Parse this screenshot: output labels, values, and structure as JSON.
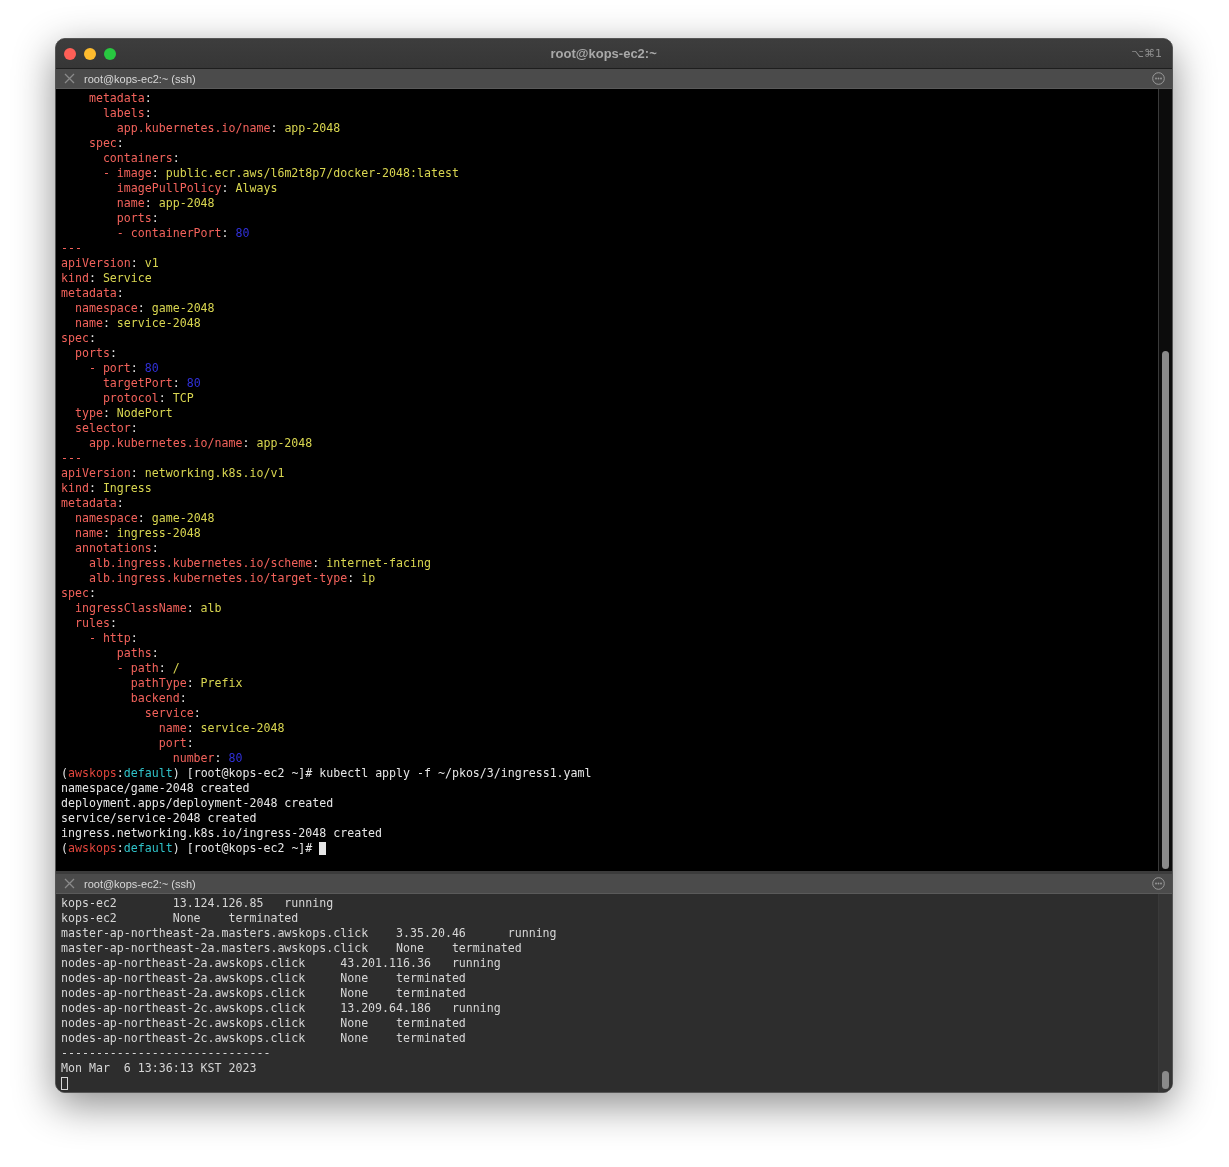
{
  "window": {
    "title": "root@kops-ec2:~",
    "shortcut": "⌥⌘1"
  },
  "panes": [
    {
      "title": "root@kops-ec2:~ (ssh)",
      "active": true,
      "lines": [
        [
          {
            "kind": "key",
            "text": "    metadata"
          },
          {
            "kind": "punct",
            "text": ":"
          }
        ],
        [
          {
            "kind": "key",
            "text": "      labels"
          },
          {
            "kind": "punct",
            "text": ":"
          }
        ],
        [
          {
            "kind": "key",
            "text": "        app.kubernetes.io/name"
          },
          {
            "kind": "punct",
            "text": ": "
          },
          {
            "kind": "value",
            "text": "app-2048"
          }
        ],
        [
          {
            "kind": "key",
            "text": "    spec"
          },
          {
            "kind": "punct",
            "text": ":"
          }
        ],
        [
          {
            "kind": "key",
            "text": "      containers"
          },
          {
            "kind": "punct",
            "text": ":"
          }
        ],
        [
          {
            "kind": "key",
            "text": "      - image"
          },
          {
            "kind": "punct",
            "text": ": "
          },
          {
            "kind": "value",
            "text": "public.ecr.aws/l6m2t8p7/docker-2048:latest"
          }
        ],
        [
          {
            "kind": "key",
            "text": "        imagePullPolicy"
          },
          {
            "kind": "punct",
            "text": ": "
          },
          {
            "kind": "value",
            "text": "Always"
          }
        ],
        [
          {
            "kind": "key",
            "text": "        name"
          },
          {
            "kind": "punct",
            "text": ": "
          },
          {
            "kind": "value",
            "text": "app-2048"
          }
        ],
        [
          {
            "kind": "key",
            "text": "        ports"
          },
          {
            "kind": "punct",
            "text": ":"
          }
        ],
        [
          {
            "kind": "key",
            "text": "        - containerPort"
          },
          {
            "kind": "punct",
            "text": ": "
          },
          {
            "kind": "number",
            "text": "80"
          }
        ],
        [
          {
            "kind": "key",
            "text": "---"
          }
        ],
        [
          {
            "kind": "key",
            "text": "apiVersion"
          },
          {
            "kind": "punct",
            "text": ": "
          },
          {
            "kind": "value",
            "text": "v1"
          }
        ],
        [
          {
            "kind": "key",
            "text": "kind"
          },
          {
            "kind": "punct",
            "text": ": "
          },
          {
            "kind": "value",
            "text": "Service"
          }
        ],
        [
          {
            "kind": "key",
            "text": "metadata"
          },
          {
            "kind": "punct",
            "text": ":"
          }
        ],
        [
          {
            "kind": "key",
            "text": "  namespace"
          },
          {
            "kind": "punct",
            "text": ": "
          },
          {
            "kind": "value",
            "text": "game-2048"
          }
        ],
        [
          {
            "kind": "key",
            "text": "  name"
          },
          {
            "kind": "punct",
            "text": ": "
          },
          {
            "kind": "value",
            "text": "service-2048"
          }
        ],
        [
          {
            "kind": "key",
            "text": "spec"
          },
          {
            "kind": "punct",
            "text": ":"
          }
        ],
        [
          {
            "kind": "key",
            "text": "  ports"
          },
          {
            "kind": "punct",
            "text": ":"
          }
        ],
        [
          {
            "kind": "key",
            "text": "    - port"
          },
          {
            "kind": "punct",
            "text": ": "
          },
          {
            "kind": "number",
            "text": "80"
          }
        ],
        [
          {
            "kind": "key",
            "text": "      targetPort"
          },
          {
            "kind": "punct",
            "text": ": "
          },
          {
            "kind": "number",
            "text": "80"
          }
        ],
        [
          {
            "kind": "key",
            "text": "      protocol"
          },
          {
            "kind": "punct",
            "text": ": "
          },
          {
            "kind": "value",
            "text": "TCP"
          }
        ],
        [
          {
            "kind": "key",
            "text": "  type"
          },
          {
            "kind": "punct",
            "text": ": "
          },
          {
            "kind": "value",
            "text": "NodePort"
          }
        ],
        [
          {
            "kind": "key",
            "text": "  selector"
          },
          {
            "kind": "punct",
            "text": ":"
          }
        ],
        [
          {
            "kind": "key",
            "text": "    app.kubernetes.io/name"
          },
          {
            "kind": "punct",
            "text": ": "
          },
          {
            "kind": "value",
            "text": "app-2048"
          }
        ],
        [
          {
            "kind": "key",
            "text": "---"
          }
        ],
        [
          {
            "kind": "key",
            "text": "apiVersion"
          },
          {
            "kind": "punct",
            "text": ": "
          },
          {
            "kind": "value",
            "text": "networking.k8s.io/v1"
          }
        ],
        [
          {
            "kind": "key",
            "text": "kind"
          },
          {
            "kind": "punct",
            "text": ": "
          },
          {
            "kind": "value",
            "text": "Ingress"
          }
        ],
        [
          {
            "kind": "key",
            "text": "metadata"
          },
          {
            "kind": "punct",
            "text": ":"
          }
        ],
        [
          {
            "kind": "key",
            "text": "  namespace"
          },
          {
            "kind": "punct",
            "text": ": "
          },
          {
            "kind": "value",
            "text": "game-2048"
          }
        ],
        [
          {
            "kind": "key",
            "text": "  name"
          },
          {
            "kind": "punct",
            "text": ": "
          },
          {
            "kind": "value",
            "text": "ingress-2048"
          }
        ],
        [
          {
            "kind": "key",
            "text": "  annotations"
          },
          {
            "kind": "punct",
            "text": ":"
          }
        ],
        [
          {
            "kind": "key",
            "text": "    alb.ingress.kubernetes.io/scheme"
          },
          {
            "kind": "punct",
            "text": ": "
          },
          {
            "kind": "value",
            "text": "internet-facing"
          }
        ],
        [
          {
            "kind": "key",
            "text": "    alb.ingress.kubernetes.io/target-type"
          },
          {
            "kind": "punct",
            "text": ": "
          },
          {
            "kind": "value",
            "text": "ip"
          }
        ],
        [
          {
            "kind": "key",
            "text": "spec"
          },
          {
            "kind": "punct",
            "text": ":"
          }
        ],
        [
          {
            "kind": "key",
            "text": "  ingressClassName"
          },
          {
            "kind": "punct",
            "text": ": "
          },
          {
            "kind": "value",
            "text": "alb"
          }
        ],
        [
          {
            "kind": "key",
            "text": "  rules"
          },
          {
            "kind": "punct",
            "text": ":"
          }
        ],
        [
          {
            "kind": "key",
            "text": "    - http"
          },
          {
            "kind": "punct",
            "text": ":"
          }
        ],
        [
          {
            "kind": "key",
            "text": "        paths"
          },
          {
            "kind": "punct",
            "text": ":"
          }
        ],
        [
          {
            "kind": "key",
            "text": "        - path"
          },
          {
            "kind": "punct",
            "text": ": "
          },
          {
            "kind": "value",
            "text": "/"
          }
        ],
        [
          {
            "kind": "key",
            "text": "          pathType"
          },
          {
            "kind": "punct",
            "text": ": "
          },
          {
            "kind": "value",
            "text": "Prefix"
          }
        ],
        [
          {
            "kind": "key",
            "text": "          backend"
          },
          {
            "kind": "punct",
            "text": ":"
          }
        ],
        [
          {
            "kind": "key",
            "text": "            service"
          },
          {
            "kind": "punct",
            "text": ":"
          }
        ],
        [
          {
            "kind": "key",
            "text": "              name"
          },
          {
            "kind": "punct",
            "text": ": "
          },
          {
            "kind": "value",
            "text": "service-2048"
          }
        ],
        [
          {
            "kind": "key",
            "text": "              port"
          },
          {
            "kind": "punct",
            "text": ":"
          }
        ],
        [
          {
            "kind": "key",
            "text": "                number"
          },
          {
            "kind": "punct",
            "text": ": "
          },
          {
            "kind": "number",
            "text": "80"
          }
        ],
        [
          {
            "kind": "punct",
            "text": "("
          },
          {
            "kind": "profile",
            "text": "awskops"
          },
          {
            "kind": "punct",
            "text": ":"
          },
          {
            "kind": "context",
            "text": "default"
          },
          {
            "kind": "punct",
            "text": ") [root@kops-ec2 ~]# kubectl apply -f ~/pkos/3/ingress1.yaml"
          }
        ],
        [
          {
            "kind": "punct",
            "text": "namespace/game-2048 created"
          }
        ],
        [
          {
            "kind": "punct",
            "text": "deployment.apps/deployment-2048 created"
          }
        ],
        [
          {
            "kind": "punct",
            "text": "service/service-2048 created"
          }
        ],
        [
          {
            "kind": "punct",
            "text": "ingress.networking.k8s.io/ingress-2048 created"
          }
        ],
        [
          {
            "kind": "punct",
            "text": "("
          },
          {
            "kind": "profile",
            "text": "awskops"
          },
          {
            "kind": "punct",
            "text": ":"
          },
          {
            "kind": "context",
            "text": "default"
          },
          {
            "kind": "punct",
            "text": ") [root@kops-ec2 ~]# "
          }
        ]
      ]
    },
    {
      "title": "root@kops-ec2:~ (ssh)",
      "active": false,
      "lines": [
        [
          {
            "kind": "punct",
            "text": "kops-ec2        13.124.126.85   running"
          }
        ],
        [
          {
            "kind": "punct",
            "text": "kops-ec2        None    terminated"
          }
        ],
        [
          {
            "kind": "punct",
            "text": "master-ap-northeast-2a.masters.awskops.click    3.35.20.46      running"
          }
        ],
        [
          {
            "kind": "punct",
            "text": "master-ap-northeast-2a.masters.awskops.click    None    terminated"
          }
        ],
        [
          {
            "kind": "punct",
            "text": "nodes-ap-northeast-2a.awskops.click     43.201.116.36   running"
          }
        ],
        [
          {
            "kind": "punct",
            "text": "nodes-ap-northeast-2a.awskops.click     None    terminated"
          }
        ],
        [
          {
            "kind": "punct",
            "text": "nodes-ap-northeast-2a.awskops.click     None    terminated"
          }
        ],
        [
          {
            "kind": "punct",
            "text": "nodes-ap-northeast-2c.awskops.click     13.209.64.186   running"
          }
        ],
        [
          {
            "kind": "punct",
            "text": "nodes-ap-northeast-2c.awskops.click     None    terminated"
          }
        ],
        [
          {
            "kind": "punct",
            "text": "nodes-ap-northeast-2c.awskops.click     None    terminated"
          }
        ],
        [
          {
            "kind": "punct",
            "text": "------------------------------"
          }
        ],
        [
          {
            "kind": "punct",
            "text": "Mon Mar  6 13:36:13 KST 2023"
          }
        ]
      ]
    }
  ]
}
